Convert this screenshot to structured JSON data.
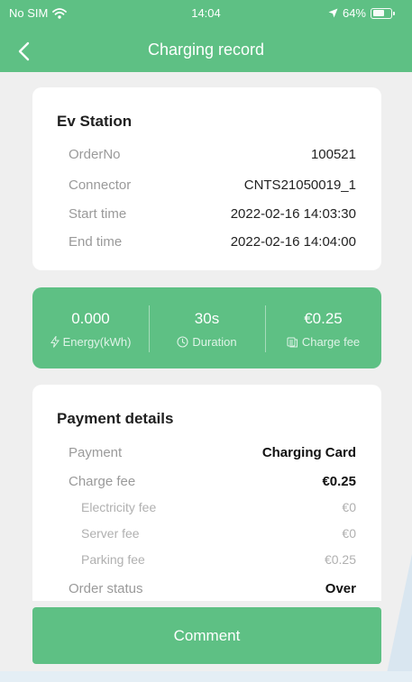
{
  "status_bar": {
    "carrier": "No SIM",
    "time": "14:04",
    "battery": "64%",
    "icons": [
      "wifi-icon",
      "location-arrow-icon",
      "battery-icon"
    ]
  },
  "nav": {
    "title": "Charging record",
    "back_icon": "chevron-left-icon"
  },
  "station": {
    "title": "Ev Station",
    "rows": [
      {
        "label": "OrderNo",
        "value": "100521"
      },
      {
        "label": "Connector",
        "value": "CNTS21050019_1"
      },
      {
        "label": "Start time",
        "value": "2022-02-16 14:03:30"
      },
      {
        "label": "End time",
        "value": "2022-02-16 14:04:00"
      }
    ]
  },
  "stats": [
    {
      "value": "0.000",
      "label": "Energy(kWh)",
      "icon": "lightning-icon"
    },
    {
      "value": "30s",
      "label": "Duration",
      "icon": "clock-icon"
    },
    {
      "value": "€0.25",
      "label": "Charge fee",
      "icon": "coins-icon"
    }
  ],
  "payment": {
    "title": "Payment details",
    "payment": {
      "label": "Payment",
      "value": "Charging Card"
    },
    "charge_fee": {
      "label": "Charge fee",
      "value": "€0.25"
    },
    "sub_rows": [
      {
        "label": "Electricity fee",
        "value": "€0"
      },
      {
        "label": "Server fee",
        "value": "€0"
      },
      {
        "label": "Parking fee",
        "value": "€0.25"
      }
    ],
    "order_status": {
      "label": "Order status",
      "value": "Over"
    }
  },
  "comment_button": {
    "label": "Comment"
  },
  "colors": {
    "accent": "#5ec084",
    "background": "#efefef",
    "muted_text": "#9a9a9a"
  }
}
